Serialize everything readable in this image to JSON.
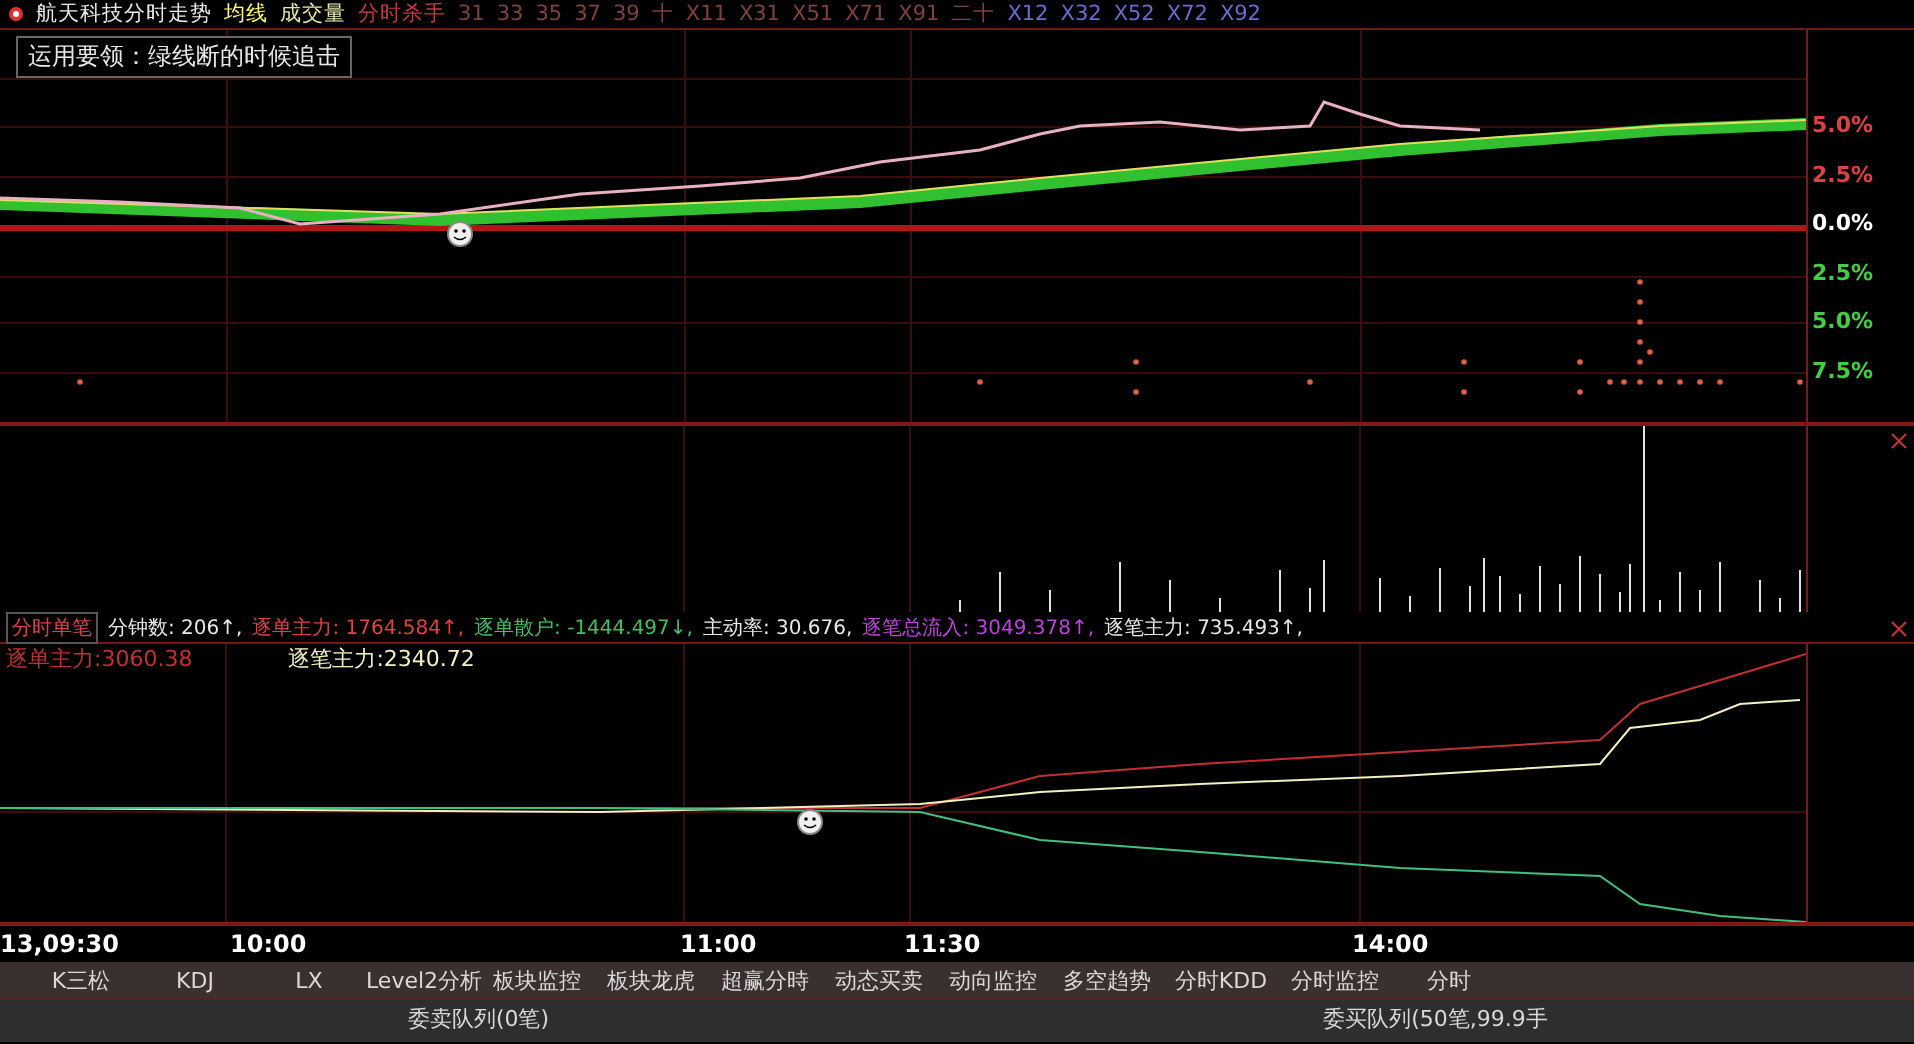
{
  "header": {
    "items": [
      {
        "text": "航天科技分时走势",
        "color": "#e8e8e8"
      },
      {
        "text": "均线",
        "color": "#ffff66"
      },
      {
        "text": "成交量",
        "color": "#e8e8a8"
      },
      {
        "text": "分时杀手",
        "color": "#c83838"
      },
      {
        "text": "31",
        "color": "#804040"
      },
      {
        "text": "33",
        "color": "#804040"
      },
      {
        "text": "35",
        "color": "#804040"
      },
      {
        "text": "37",
        "color": "#804040"
      },
      {
        "text": "39",
        "color": "#804040"
      },
      {
        "text": "十",
        "color": "#804040"
      },
      {
        "text": "X11",
        "color": "#804040"
      },
      {
        "text": "X31",
        "color": "#804040"
      },
      {
        "text": "X51",
        "color": "#804040"
      },
      {
        "text": "X71",
        "color": "#804040"
      },
      {
        "text": "X91",
        "color": "#804040"
      },
      {
        "text": "二十",
        "color": "#804040"
      },
      {
        "text": "X12",
        "color": "#6a6ad0"
      },
      {
        "text": "X32",
        "color": "#6a6ad0"
      },
      {
        "text": "X52",
        "color": "#6a6ad0"
      },
      {
        "text": "X72",
        "color": "#6a6ad0"
      },
      {
        "text": "X92",
        "color": "#6a6ad0"
      }
    ]
  },
  "note": "运用要领：绿线断的时候追击",
  "price_axis": [
    {
      "label": "5.0%",
      "color": "#e04040"
    },
    {
      "label": "2.5%",
      "color": "#e04040"
    },
    {
      "label": "0.0%",
      "color": "#ffffff"
    },
    {
      "label": "2.5%",
      "color": "#40d040"
    },
    {
      "label": "5.0%",
      "color": "#40d040"
    },
    {
      "label": "7.5%",
      "color": "#40d040"
    }
  ],
  "indicator": {
    "title": "分时单笔",
    "values": [
      {
        "text": "分钟数: 206↑,",
        "color": "#e8e8e8"
      },
      {
        "text": "逐单主力: 1764.584↑,",
        "color": "#e04040"
      },
      {
        "text": "逐单散户: -1444.497↓,",
        "color": "#40c060"
      },
      {
        "text": "主动率: 30.676,",
        "color": "#e8e8e8"
      },
      {
        "text": "逐笔总流入: 3049.378↑,",
        "color": "#c040e0"
      },
      {
        "text": "逐笔主力: 735.493↑,",
        "color": "#e8e8e8"
      }
    ]
  },
  "legend": [
    {
      "text": "逐单主力:3060.38",
      "color": "#c03030"
    },
    {
      "text": "逐笔主力:2340.72",
      "color": "#f0f0c0"
    }
  ],
  "time_axis": [
    "13,09:30",
    "10:00",
    "11:00",
    "11:30",
    "14:00"
  ],
  "tabs": [
    {
      "label": "K三松",
      "selected": false
    },
    {
      "label": "KDJ",
      "selected": false
    },
    {
      "label": "LX",
      "selected": false
    },
    {
      "label": "Level2分析",
      "selected": false
    },
    {
      "label": "板块监控",
      "selected": false
    },
    {
      "label": "板块龙虎",
      "selected": false
    },
    {
      "label": "超赢分時",
      "selected": false
    },
    {
      "label": "动态买卖",
      "selected": false
    },
    {
      "label": "动向监控",
      "selected": false
    },
    {
      "label": "多空趋势",
      "selected": false
    },
    {
      "label": "分时KDD",
      "selected": false
    },
    {
      "label": "分时监控",
      "selected": false
    },
    {
      "label": "分时",
      "selected": false
    }
  ],
  "queues": [
    "委卖队列(0笔)",
    "委买队列(50笔,99.9手"
  ]
}
